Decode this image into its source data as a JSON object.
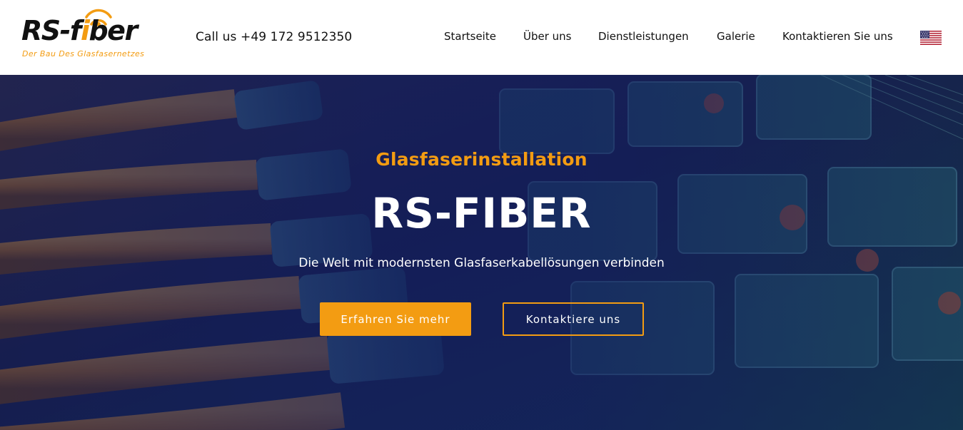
{
  "brand": {
    "name_dark": "RS-",
    "name_orange_i": "i",
    "name_f": "f",
    "name_rest": "ber",
    "tagline": "Der Bau Des Glasfasernetzes",
    "accent_color": "#f39c12"
  },
  "header": {
    "phone": "Call us +49 172 9512350",
    "nav": [
      {
        "label": "Startseite"
      },
      {
        "label": "Über uns"
      },
      {
        "label": "Dienstleistungen"
      },
      {
        "label": "Galerie"
      },
      {
        "label": "Kontaktieren Sie uns"
      }
    ],
    "language_icon": "us-flag-icon"
  },
  "hero": {
    "kicker": "Glasfaserinstallation",
    "title": "RS-FIBER",
    "subtitle": "Die Welt mit modernsten Glasfaserkabellösungen verbinden",
    "primary_button": "Erfahren Sie mehr",
    "secondary_button": "Kontaktiere uns",
    "overlay_color": "#101a5a"
  }
}
